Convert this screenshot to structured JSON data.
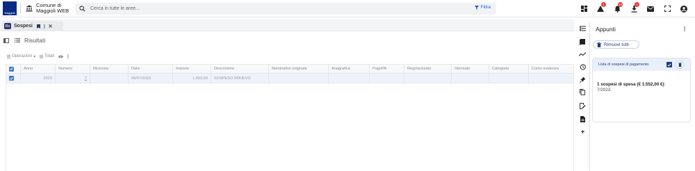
{
  "header": {
    "logo_text": "Maggioli",
    "org_line1": "Comune di",
    "org_line2": "Maggioli WEB",
    "search_placeholder": "Cerca in tutte le aree...",
    "filter_label": "Filtra",
    "badges": {
      "alerts": "1",
      "notifications": "14",
      "downloads": "1"
    }
  },
  "tab": {
    "label": "Sospesi",
    "icon_text": "Ra"
  },
  "results": {
    "title": "Risultati"
  },
  "toolbar": {
    "operations": "Operazioni",
    "totals": "Totali"
  },
  "table": {
    "columns": [
      "Anno",
      "Numero",
      "Ricevuta",
      "Data",
      "Importo",
      "Descrizione",
      "Nominativo originale",
      "Anagrafica",
      "PagoPA",
      "Regolarizzato",
      "Storniato",
      "Categoria",
      "Conto evidenza"
    ],
    "rows": [
      {
        "anno": "2023",
        "numero": "7",
        "ricevuta": "",
        "data": "06/07/2023",
        "importo": "1.552,00",
        "descrizione": "SOSPESO WIKIEVO",
        "nominativo": "",
        "anagrafica": "",
        "pagopa": "",
        "regolarizzato": "",
        "storniato": "",
        "categoria": "",
        "conto": ""
      }
    ]
  },
  "panel": {
    "title": "Appunti",
    "remove_all": "Rimuovi tutti",
    "card_title": "Lista di sospesi di pagamento",
    "summary_bold": "1 sospesi di spesa (€ 1.552,00 €)",
    "summary_tail": ":",
    "detail": "7/2023"
  },
  "colors": {
    "accent": "#1d3b7a",
    "selected_row": "#eef3fb",
    "badge": "#e53935"
  }
}
